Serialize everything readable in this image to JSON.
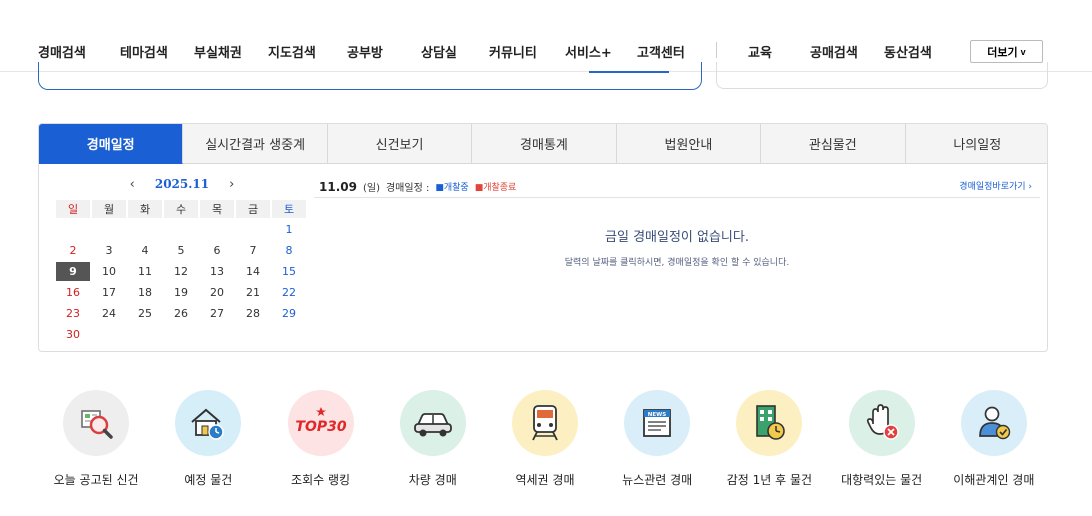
{
  "nav": {
    "items": [
      "경매검색",
      "테마검색",
      "부실채권",
      "지도검색",
      "공부방",
      "상담실",
      "커뮤니티",
      "서비스+",
      "고객센터"
    ],
    "extra": [
      "교육",
      "공매검색",
      "동산검색"
    ],
    "more_label": "더보기",
    "more_icon": "chevron-down-icon"
  },
  "schedule": {
    "tabs": [
      "경매일정",
      "실시간결과 생중계",
      "신건보기",
      "경매통계",
      "법원안내",
      "관심물건",
      "나의일정"
    ],
    "active_tab": 0,
    "calendar": {
      "month_label": "2025.11",
      "prev_icon": "chevron-left-icon",
      "next_icon": "chevron-right-icon",
      "weekdays": [
        "일",
        "월",
        "화",
        "수",
        "목",
        "금",
        "토"
      ],
      "weeks": [
        [
          "",
          "",
          "",
          "",
          "",
          "",
          "1"
        ],
        [
          "2",
          "3",
          "4",
          "5",
          "6",
          "7",
          "8"
        ],
        [
          "9",
          "10",
          "11",
          "12",
          "13",
          "14",
          "15"
        ],
        [
          "16",
          "17",
          "18",
          "19",
          "20",
          "21",
          "22"
        ],
        [
          "23",
          "24",
          "25",
          "26",
          "27",
          "28",
          "29"
        ],
        [
          "30",
          "",
          "",
          "",
          "",
          "",
          ""
        ]
      ],
      "today": "9"
    },
    "date": "11.09",
    "dow": "(일)",
    "label": "경매일정 :",
    "legend_open": "■개찰중",
    "legend_closed": "■개찰종료",
    "link": "경매일정바로가기 ›",
    "empty_title": "금일 경매일정이 없습니다.",
    "empty_sub": "달력의 날짜를 클릭하시면, 경매일정을 확인 할 수 있습니다."
  },
  "quick": [
    {
      "label": "오늘 공고된 신건",
      "icon": "magnifier-document-icon",
      "bg": "#eeeeee"
    },
    {
      "label": "예정 물건",
      "icon": "house-clock-icon",
      "bg": "#d6eef8"
    },
    {
      "label": "조회수 랭킹",
      "icon": "top30-icon",
      "text": "TOP30",
      "bg": "#fde3e3"
    },
    {
      "label": "차량 경매",
      "icon": "car-icon",
      "bg": "#dbf0e6"
    },
    {
      "label": "역세권 경매",
      "icon": "train-icon",
      "bg": "#fcefc2"
    },
    {
      "label": "뉴스관련 경매",
      "icon": "newspaper-icon",
      "text": "NEWS",
      "bg": "#d9eef8"
    },
    {
      "label": "감정 1년 후 물건",
      "icon": "building-clock-icon",
      "bg": "#fcefc2"
    },
    {
      "label": "대항력있는 물건",
      "icon": "hand-stop-icon",
      "bg": "#dbf0e6"
    },
    {
      "label": "이해관계인 경매",
      "icon": "person-check-icon",
      "bg": "#d9eef8"
    }
  ],
  "colors": {
    "accent": "#1a5fd4",
    "sunday": "#d32020",
    "closed": "#e2443a"
  }
}
